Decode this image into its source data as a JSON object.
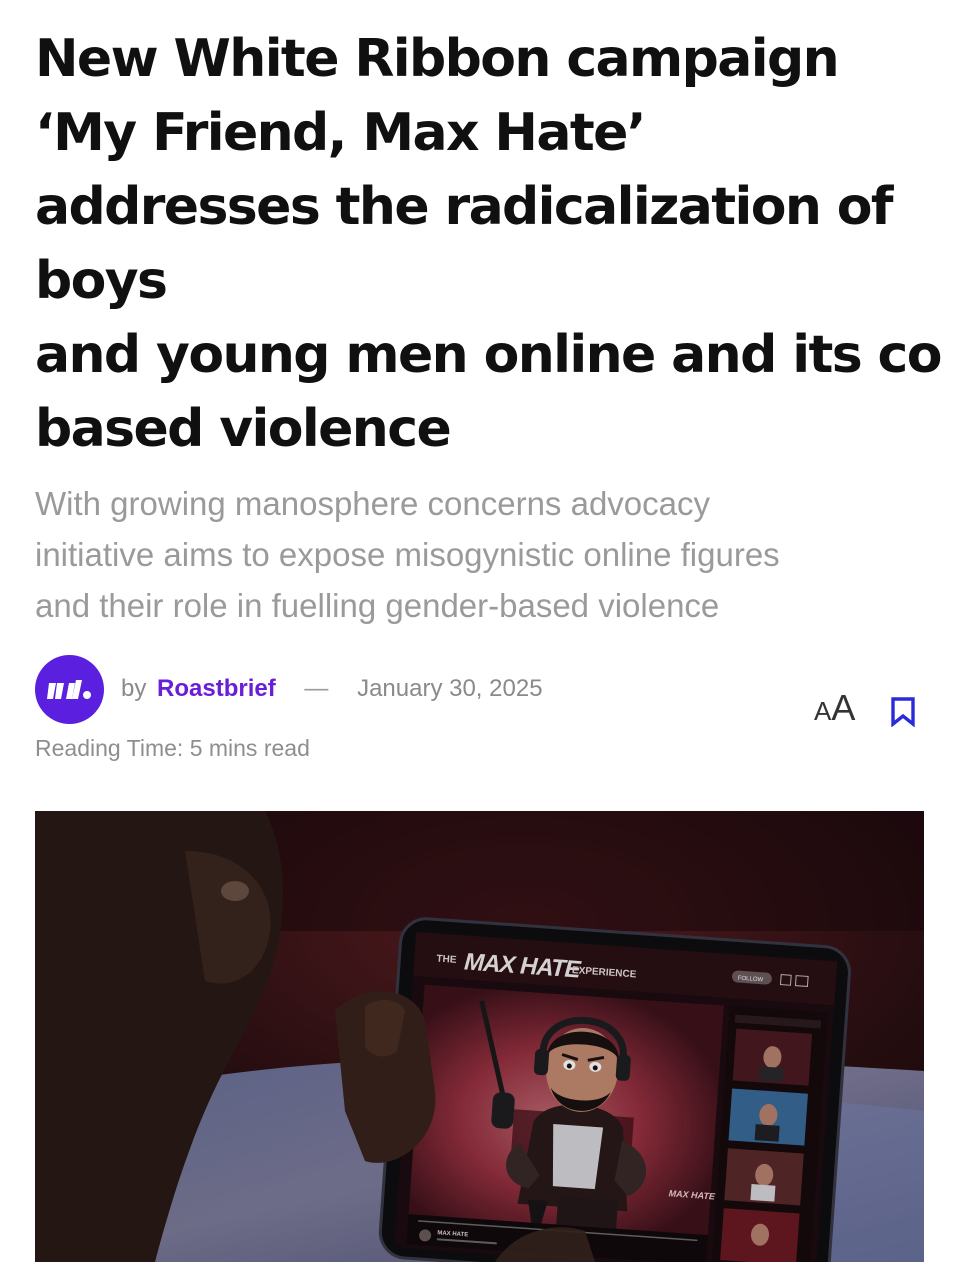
{
  "article": {
    "title_lines": [
      "New White Ribbon campaign",
      "‘My Friend, Max Hate’",
      "addresses the radicalization of",
      "boys",
      "and young men online and its co",
      "based violence"
    ],
    "subtitle_lines": [
      "With growing manosphere concerns advocacy",
      "initiative aims to expose misogynistic online figures",
      "and their role in fuelling gender-based violence"
    ],
    "byline": {
      "by": "by",
      "author": "Roastbrief",
      "separator": "—",
      "date": "January 30, 2025"
    },
    "reading_time": "Reading Time: 5 mins read",
    "controls": {
      "font_small": "A",
      "font_big": "A",
      "bookmark_icon": "bookmark-icon"
    },
    "hero_image": {
      "screen": {
        "the": "THE",
        "brand": "MAX HATE",
        "experience": "EXPERIENCE",
        "follow": "FOLLOW",
        "caption_name": "MAX HATE"
      }
    },
    "colors": {
      "author": "#6a1fd6",
      "avatar": "#5b1fe0",
      "bookmark": "#2a2ad8",
      "subtitle": "#9a9a9a"
    }
  }
}
